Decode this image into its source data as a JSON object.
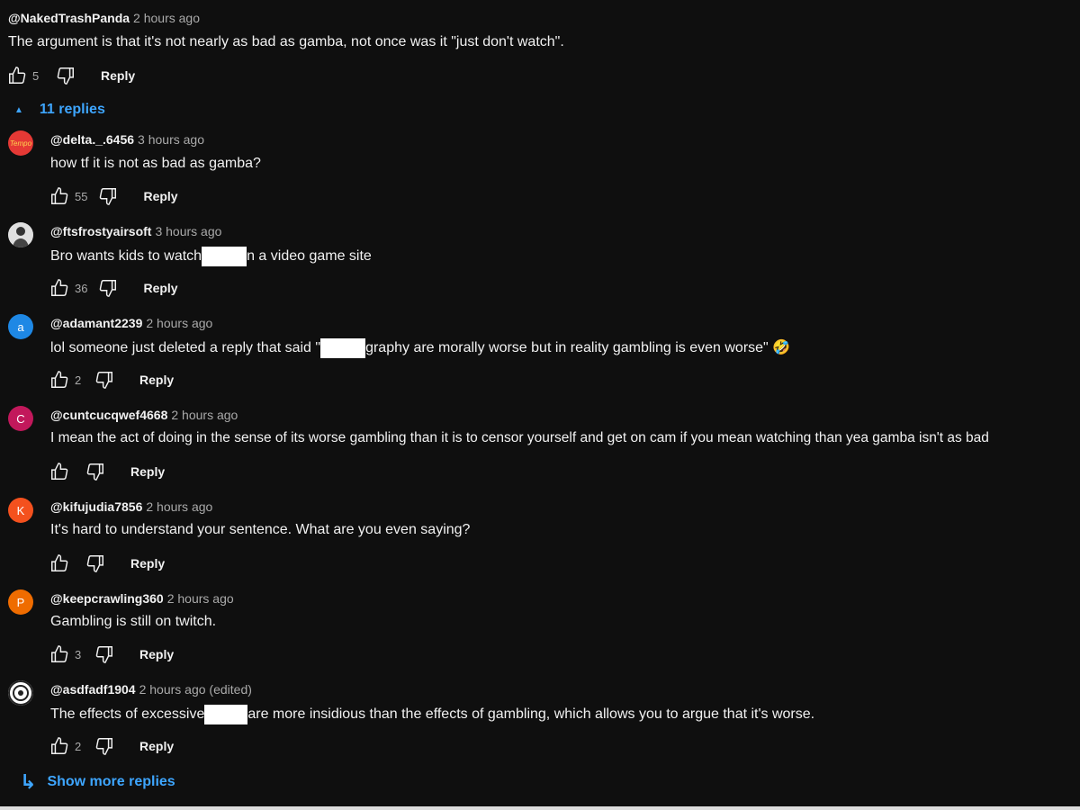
{
  "top_comment": {
    "handle": "@NakedTrashPanda",
    "time": "2 hours ago",
    "text": "The argument is that it's not nearly as bad as gamba, not once was it \"just don't watch\".",
    "likes": "5",
    "reply_label": "Reply"
  },
  "replies_toggle": {
    "arrow": "▲",
    "label": "11 replies"
  },
  "replies": [
    {
      "handle": "@delta._.6456",
      "time": "3 hours ago",
      "text": "how tf it is not as bad as gamba?",
      "likes": "55",
      "reply_label": "Reply",
      "avatar": "Tempo",
      "avatar_color": "#e53935"
    },
    {
      "handle": "@ftsfrostyairsoft",
      "time": "3 hours ago",
      "text_before": "Bro wants kids to watch",
      "text_after": "n a video game site",
      "likes": "36",
      "reply_label": "Reply",
      "avatar": "",
      "avatar_color": "#555555"
    },
    {
      "handle": "@adamant2239",
      "time": "2 hours ago",
      "text_before": "lol someone just deleted a reply that said \"",
      "text_after": "graphy are morally worse but in reality gambling is even worse\" 🤣",
      "likes": "2",
      "reply_label": "Reply",
      "avatar": "a",
      "avatar_color": "#1e88e5"
    },
    {
      "handle": "@cuntcucqwef4668",
      "time": "2 hours ago",
      "text": "I mean the act of doing in the sense of its worse  gambling than it is to censor yourself and get on cam if you mean watching than yea gamba isn't as bad",
      "likes": "",
      "reply_label": "Reply",
      "avatar": "C",
      "avatar_color": "#c2185b"
    },
    {
      "handle": "@kifujudia7856",
      "time": "2 hours ago",
      "text": "It's hard to understand your sentence. What are you even saying?",
      "likes": "",
      "reply_label": "Reply",
      "avatar": "K",
      "avatar_color": "#f4511e"
    },
    {
      "handle": "@keepcrawling360",
      "time": "2 hours ago",
      "text": "Gambling is still on twitch.",
      "likes": "3",
      "reply_label": "Reply",
      "avatar": "P",
      "avatar_color": "#ef6c00"
    },
    {
      "handle": "@asdfadf1904",
      "time": "2 hours ago (edited)",
      "text_before": "The effects of excessive",
      "text_after": "are more insidious than the effects of gambling, which allows you to argue that it's worse.",
      "likes": "2",
      "reply_label": "Reply",
      "avatar": "",
      "avatar_color": "#e0e0e0"
    }
  ],
  "show_more": {
    "arrow": "↳",
    "label": "Show more replies"
  },
  "colors": {
    "background": "#0f0f0f",
    "link": "#3ea6ff",
    "muted": "#aaaaaa"
  },
  "icons": [
    "thumb-up-icon",
    "thumb-down-icon",
    "chevron-up-icon",
    "reply-arrow-icon"
  ]
}
